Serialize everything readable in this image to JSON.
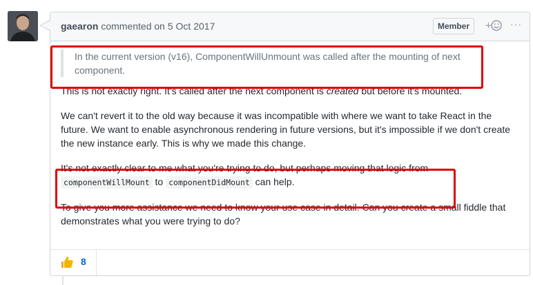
{
  "comment": {
    "author": "gaearon",
    "action": "commented on",
    "date": "5 Oct 2017",
    "badge": "Member",
    "more_label": "···",
    "quote": "In the current version (v16), ComponentWillUnmount was called after the mounting of next component.",
    "para1_a": "This is not exactly right. It's called after the next component is ",
    "para1_em": "created",
    "para1_b": " but before it's mounted.",
    "para2": "We can't revert it to the old way because it was incompatible with where we want to take React in the future. We want to enable asynchronous rendering in future versions, but it's impossible if we don't create the new instance early. This is why we made this change.",
    "para3_a": "It's not exactly clear to me what you're trying to do, but perhaps moving that logic from",
    "code1": "componentWillMount",
    "para3_to": " to ",
    "code2": "componentDidMount",
    "para3_b": " can help.",
    "para4": "To give you more assistance we need to know your use case in detail. Can you create a small fiddle that demonstrates what you were trying to do?"
  },
  "reactions": [
    {
      "icon": "thumbs-up-icon",
      "count": "8"
    }
  ],
  "colors": {
    "highlight": "#e00000",
    "link": "#0366d6",
    "thumb": "#f4b400"
  }
}
